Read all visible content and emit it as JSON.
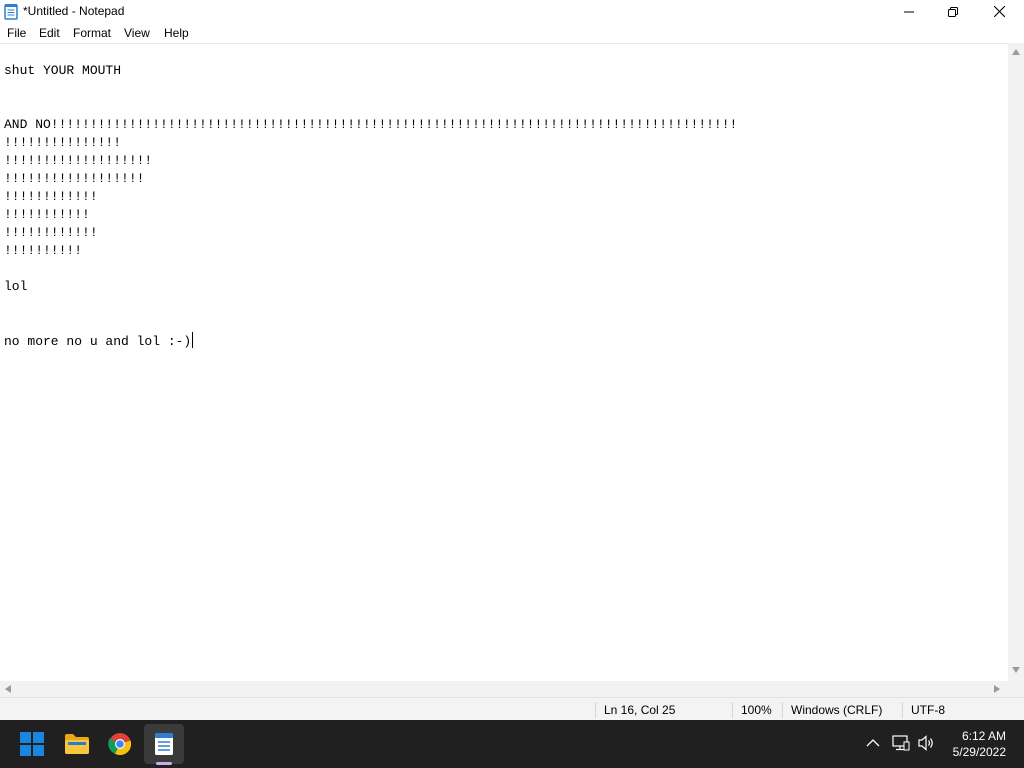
{
  "window": {
    "title": "*Untitled - Notepad",
    "app_icon": "notepad-icon"
  },
  "menu": {
    "items": [
      "File",
      "Edit",
      "Format",
      "View",
      "Help"
    ]
  },
  "editor": {
    "lines": [
      "shut YOUR MOUTH",
      "",
      "",
      "AND NO!!!!!!!!!!!!!!!!!!!!!!!!!!!!!!!!!!!!!!!!!!!!!!!!!!!!!!!!!!!!!!!!!!!!!!!!!!!!!!!!!!!!!!!!",
      "!!!!!!!!!!!!!!!",
      "!!!!!!!!!!!!!!!!!!!",
      "!!!!!!!!!!!!!!!!!!",
      "!!!!!!!!!!!!",
      "!!!!!!!!!!!",
      "!!!!!!!!!!!!",
      "!!!!!!!!!!",
      "",
      "lol",
      "",
      "",
      "no more no u and lol :-)"
    ]
  },
  "status": {
    "position": "Ln 16, Col 25",
    "zoom": "100%",
    "line_ending": "Windows (CRLF)",
    "encoding": "UTF-8"
  },
  "taskbar": {
    "apps": [
      "windows-start-icon",
      "file-explorer-icon",
      "chrome-icon",
      "notepad-icon"
    ],
    "tray": [
      "chevron-up-icon",
      "network-icon",
      "volume-icon"
    ],
    "time": "6:12 AM",
    "date": "5/29/2022"
  },
  "colors": {
    "taskbar": "#202020",
    "start_blue": "#0078d4",
    "notepad_blue": "#2f7fd0",
    "active_indicator": "#d0a9e6"
  }
}
